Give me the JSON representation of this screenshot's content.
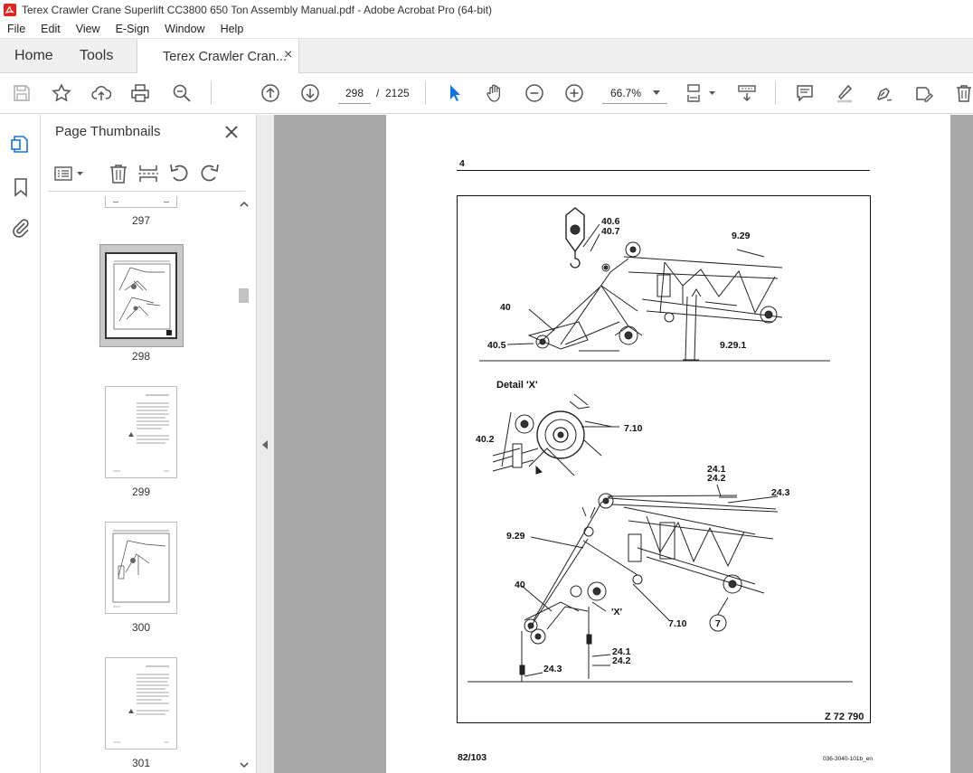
{
  "window": {
    "title": "Terex Crawler Crane Superlift CC3800 650 Ton Assembly Manual.pdf - Adobe Acrobat Pro (64-bit)"
  },
  "menu": [
    "File",
    "Edit",
    "View",
    "E-Sign",
    "Window",
    "Help"
  ],
  "tabs": {
    "home": "Home",
    "tools": "Tools",
    "document": "Terex Crawler Cran...",
    "close_glyph": "×"
  },
  "toolbar": {
    "current_page": "298",
    "separator": "/",
    "total_pages": "2125",
    "zoom": "66.7%"
  },
  "panel": {
    "title": "Page Thumbnails",
    "thumbnails": [
      {
        "label": "297",
        "selected": false
      },
      {
        "label": "298",
        "selected": true
      },
      {
        "label": "299",
        "selected": false
      },
      {
        "label": "300",
        "selected": false
      },
      {
        "label": "301",
        "selected": false
      }
    ]
  },
  "document_page": {
    "section_number": "4",
    "labels": {
      "l406": "40.6",
      "l407": "40.7",
      "l929a": "9.29",
      "l40a": "40",
      "l405": "40.5",
      "l9291": "9.29.1",
      "detail": "Detail 'X'",
      "l402": "40.2",
      "l710a": "7.10",
      "l241a": "24.1",
      "l242a": "24.2",
      "l243a": "24.3",
      "l929b": "9.29",
      "l40b": "40",
      "lx": "'X'",
      "l710b": "7.10",
      "l7": "7",
      "l241b": "24.1",
      "l242b": "24.2",
      "l243b": "24.3",
      "figure_id": "Z 72 790"
    },
    "page_counter": "82/103",
    "doc_code": "036-3040-101b_en"
  },
  "colors": {
    "accent_blue": "#1473e6",
    "acrobat_red": "#e1251b",
    "viewer_bg": "#a8a8a8"
  }
}
